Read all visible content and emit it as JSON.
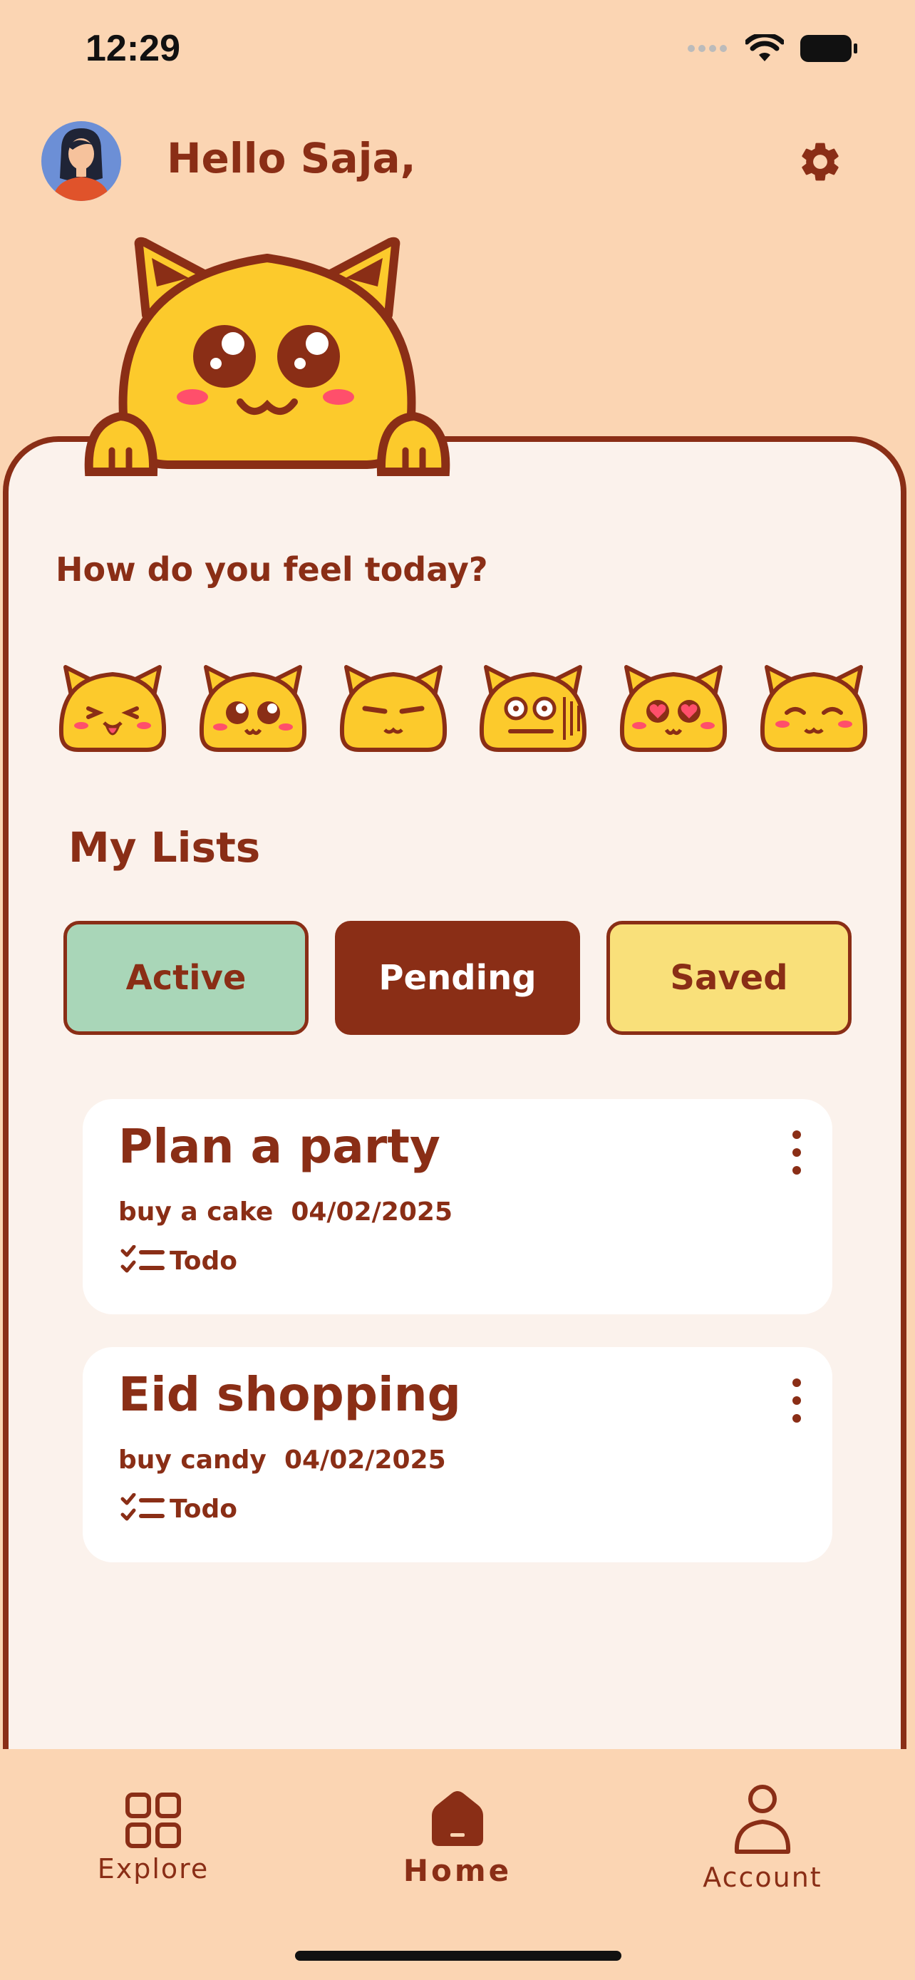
{
  "status_bar": {
    "time": "12:29"
  },
  "header": {
    "greeting": "Hello Saja,"
  },
  "mood": {
    "question": "How do you feel today?",
    "options": [
      "playful-cat",
      "amazed-cat",
      "annoyed-cat",
      "dizzy-cat",
      "in-love-cat",
      "content-cat"
    ]
  },
  "lists": {
    "title": "My Lists",
    "tabs": [
      "Active",
      "Pending",
      "Saved"
    ],
    "items": [
      {
        "title": "Plan a party",
        "subtitle": "buy a cake  04/02/2025",
        "tag": "Todo"
      },
      {
        "title": "Eid shopping",
        "subtitle": "buy candy  04/02/2025",
        "tag": "Todo"
      }
    ]
  },
  "nav": {
    "explore": "Explore",
    "home": "Home",
    "account": "Account"
  },
  "colors": {
    "background": "#fbd5b3",
    "primary": "#8a2e16",
    "panel": "#fbf2ec",
    "active_tab": "#a9d6b8",
    "saved_tab": "#f9e07a",
    "cat_yellow": "#fcca2c"
  }
}
